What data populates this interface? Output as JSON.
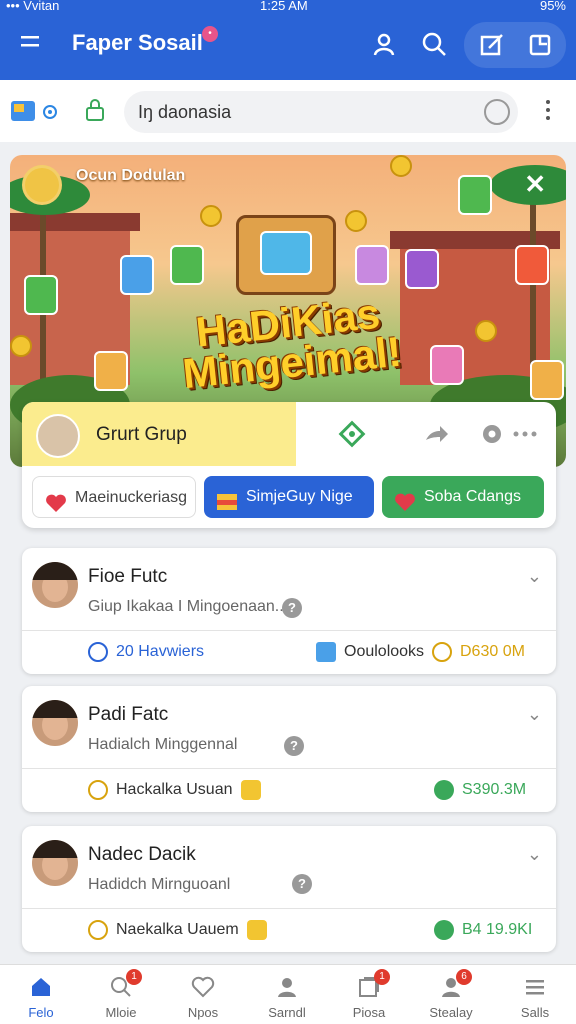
{
  "status_bar": {
    "carrier": "••• Vvitan",
    "time": "1:25 AM",
    "battery": "95%"
  },
  "header": {
    "title": "Faper Sosail",
    "icons": [
      "menu-icon",
      "profile-icon",
      "search-icon",
      "compose-icon",
      "share-icon"
    ]
  },
  "search": {
    "value": "Iŋ daonasia"
  },
  "banner": {
    "top_label": "Ocun Dodulan",
    "headline": "HaDiKias Mingeimal!"
  },
  "group": {
    "name": "Grurt Grup",
    "buttons": [
      {
        "label": "Maeinuckeriasg",
        "color": "#ffffff"
      },
      {
        "label": "SimjeGuy Nige",
        "color": "#2a63d6"
      },
      {
        "label": "Soba Cdangs",
        "color": "#3aa85a"
      }
    ]
  },
  "feed": [
    {
      "name": "Fioe Futc",
      "subtitle": "Giup Ikakaa I Mingoenaan..",
      "left_stat": "20 Havwiers",
      "mid_stat": "Ooulolooks",
      "right_stat": "D630 0M"
    },
    {
      "name": "Padi Fatc",
      "subtitle": "Hadialch Minggennal",
      "left_stat": "Hackalka Usuan",
      "right_stat": "S390.3M"
    },
    {
      "name": "Nadec Dacik",
      "subtitle": "Hadidch Mirnguoanl",
      "left_stat": "Naekalka Uauem",
      "right_stat": "B4 19.9KI"
    }
  ],
  "bottom_nav": [
    {
      "label": "Felo",
      "active": true
    },
    {
      "label": "Mloie",
      "badge": "1"
    },
    {
      "label": "Npos"
    },
    {
      "label": "Sarndl"
    },
    {
      "label": "Piosa",
      "badge": "1"
    },
    {
      "label": "Stealay",
      "badge": "6"
    },
    {
      "label": "Salls"
    }
  ]
}
